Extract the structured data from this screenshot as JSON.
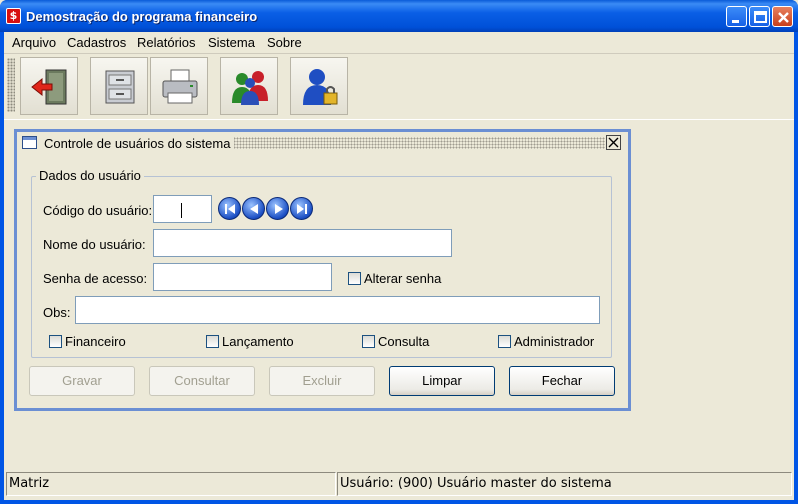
{
  "window": {
    "title": "Demostração do programa financeiro",
    "app_icon_glyph": "$"
  },
  "menu": [
    {
      "label": "Arquivo"
    },
    {
      "label": "Cadastros"
    },
    {
      "label": "Relatórios"
    },
    {
      "label": "Sistema"
    },
    {
      "label": "Sobre"
    }
  ],
  "toolbar": {
    "items": [
      {
        "icon": "exit-door-icon"
      },
      {
        "icon": "file-cabinet-icon"
      },
      {
        "icon": "printer-icon"
      },
      {
        "icon": "users-group-icon"
      },
      {
        "icon": "user-lock-icon"
      }
    ]
  },
  "internal_frame": {
    "title": "Controle de usuários do sistema"
  },
  "form": {
    "group_title": "Dados do usuário",
    "codigo_label": "Código do usuário:",
    "codigo_value": "",
    "nome_label": "Nome do usuário:",
    "nome_value": "",
    "senha_label": "Senha de acesso:",
    "senha_value": "",
    "alterar_senha_label": "Alterar senha",
    "alterar_senha_checked": false,
    "obs_label": "Obs:",
    "obs_value": "",
    "permissions": [
      {
        "label": "Financeiro",
        "checked": false
      },
      {
        "label": "Lançamento",
        "checked": false
      },
      {
        "label": "Consulta",
        "checked": false
      },
      {
        "label": "Administrador",
        "checked": false
      }
    ]
  },
  "nav_buttons": [
    "first-record-icon",
    "previous-record-icon",
    "next-record-icon",
    "last-record-icon"
  ],
  "buttons": {
    "gravar": "Gravar",
    "consultar": "Consultar",
    "excluir": "Excluir",
    "limpar": "Limpar",
    "fechar": "Fechar"
  },
  "status": {
    "company": "Matriz",
    "user": "Usuário: (900) Usuário master do sistema"
  },
  "colors": {
    "titlebar": "#0a5fe6",
    "frame_border": "#6b8fd3",
    "background": "#ece9d8"
  }
}
